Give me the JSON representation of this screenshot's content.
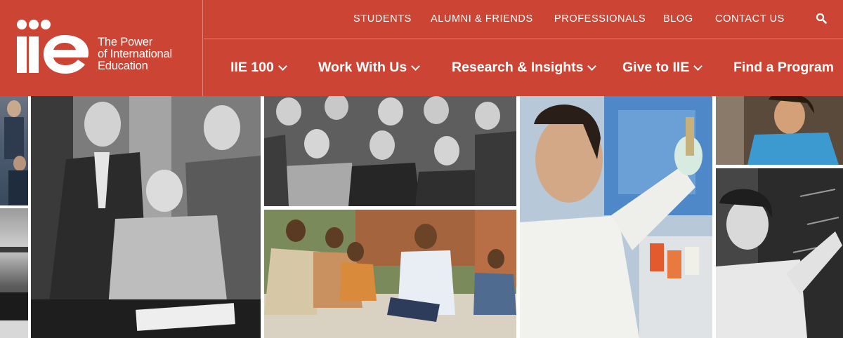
{
  "logo": {
    "mark_text": "iie",
    "tagline": [
      "The Power",
      "of International",
      "Education"
    ]
  },
  "top_nav": [
    "STUDENTS",
    "ALUMNI & FRIENDS",
    "PROFESSIONALS",
    "BLOG",
    "CONTACT US"
  ],
  "main_nav": [
    "IIE 100",
    "Work With Us",
    "Research & Insights",
    "Give to IIE",
    "Find a Program"
  ],
  "icons": {
    "search": "search-icon",
    "chevron": "chevron-down-icon"
  },
  "colors": {
    "brand": "#cc4433",
    "nav_text": "#ffffff"
  }
}
